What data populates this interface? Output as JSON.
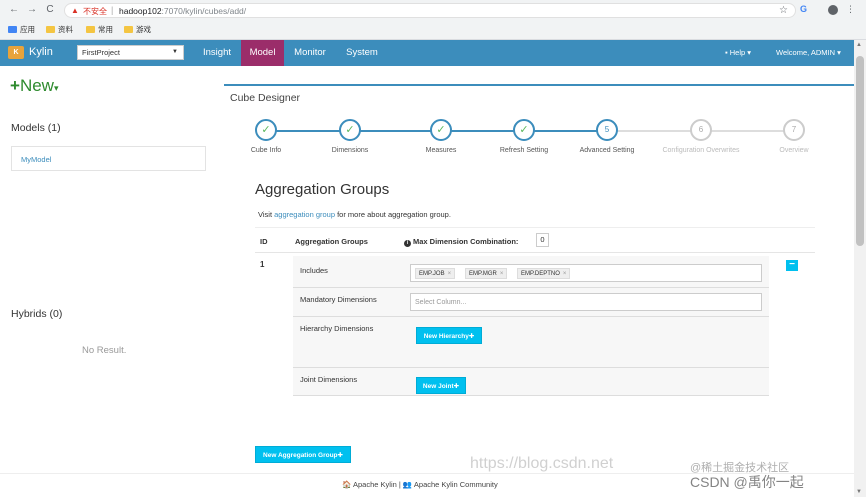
{
  "browser": {
    "back_glyph": "←",
    "forward_glyph": "→",
    "reload_glyph": "C",
    "warning_glyph": "▲",
    "insecure_label": "不安全",
    "separator": "|",
    "url_host": "hadoop102",
    "url_rest": ":7070/kylin/cubes/add/",
    "star_glyph": "☆",
    "menu_glyph": "⋮",
    "bookmarks": [
      "应用",
      "资料",
      "常用",
      "游戏"
    ]
  },
  "navbar": {
    "brand": "Kylin",
    "project": "FirstProject",
    "tabs": [
      "Insight",
      "Model",
      "Monitor",
      "System"
    ],
    "active_tab": "Model",
    "help": "Help ▾",
    "welcome": "Welcome, ADMIN ▾",
    "color_primary": "#3c8dbc",
    "color_active": "#9b2d6a"
  },
  "sidebar": {
    "new_plus": "+",
    "new_label": "New",
    "models_heading": "Models (1)",
    "models": [
      "MyModel"
    ],
    "hybrids_heading": "Hybrids (0)",
    "no_result": "No Result."
  },
  "designer": {
    "title": "Cube Designer",
    "steps": [
      {
        "label": "Cube Info",
        "state": "done",
        "mark": "✓"
      },
      {
        "label": "Dimensions",
        "state": "done",
        "mark": "✓"
      },
      {
        "label": "Measures",
        "state": "done",
        "mark": "✓"
      },
      {
        "label": "Refresh Setting",
        "state": "done",
        "mark": "✓"
      },
      {
        "label": "Advanced Setting",
        "state": "current",
        "mark": "5"
      },
      {
        "label": "Configuration Overwrites",
        "state": "todo",
        "mark": "6"
      },
      {
        "label": "Overview",
        "state": "todo",
        "mark": "7"
      }
    ]
  },
  "aggregation": {
    "title": "Aggregation Groups",
    "visit_prefix": "Visit ",
    "visit_link": "aggregation group",
    "visit_suffix": " for more about aggregation group.",
    "col_id": "ID",
    "col_groups": "Aggregation Groups",
    "col_maxdim": "Max Dimension Combination:",
    "max_dim_value": "0",
    "group_id": "1",
    "includes_label": "Includes",
    "includes": [
      "EMP.JOB",
      "EMP.MGR",
      "EMP.DEPTNO"
    ],
    "tag_remove": "×",
    "mandatory_label": "Mandatory Dimensions",
    "mandatory_placeholder": "Select Column...",
    "hierarchy_label": "Hierarchy Dimensions",
    "new_hierarchy": "New Hierarchy✚",
    "joint_label": "Joint Dimensions",
    "new_joint": "New Joint✚",
    "remove_group": "−",
    "new_group": "New Aggregation Group✚"
  },
  "footer": {
    "text": "🏠 Apache Kylin | 👥 Apache Kylin Community"
  },
  "watermark": {
    "line1": "https://blog.csdn.net",
    "line2": "@稀土掘金技术社区",
    "line3": "CSDN @禹你一起"
  }
}
